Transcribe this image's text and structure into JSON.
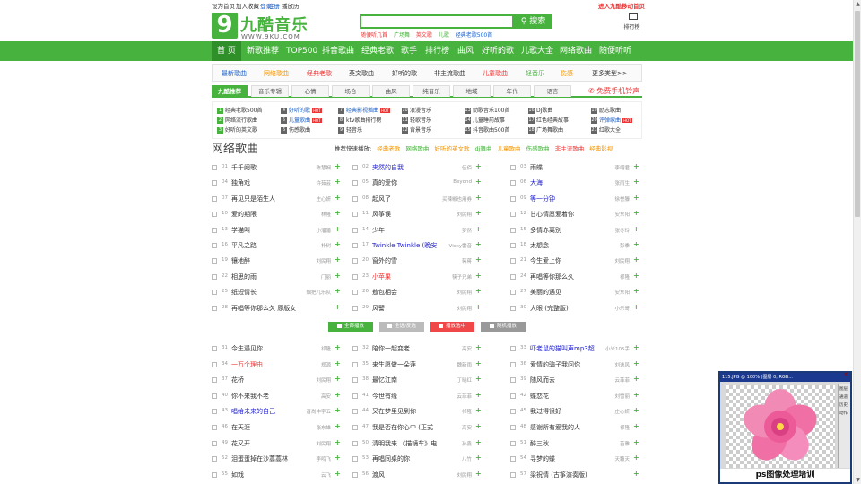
{
  "topbar": {
    "set_home": "设为首页",
    "favorite": "加入收藏",
    "login": "登录",
    "register": "注册",
    "history": "播放历",
    "link_to_mobile": "进入九酷移动首页"
  },
  "logo": {
    "mark": "9",
    "name": "九酷音乐",
    "url": "WWW.9KU.COM"
  },
  "search": {
    "placeholder": "",
    "button": "搜索"
  },
  "hotwords": [
    "随便听几首",
    "广场舞",
    "英文歌",
    "儿歌",
    "经典老歌500首"
  ],
  "rank_label": "排行榜",
  "nav": [
    "首 页",
    "新歌推荐",
    "TOP500",
    "抖音歌曲",
    "经典老歌",
    "歌手",
    "排行榜",
    "曲风",
    "好听的歌",
    "儿歌大全",
    "网络歌曲",
    "随便听听"
  ],
  "subnav": [
    "最新歌曲",
    "网络歌曲",
    "经典老歌",
    "英文歌曲",
    "好听的歌",
    "非主流歌曲",
    "儿童歌曲",
    "轻音乐",
    "伤感",
    "更多类型>>"
  ],
  "tabs": [
    "九酷推荐",
    "音乐专辑",
    "心情",
    "场合",
    "曲风",
    "纯音乐",
    "地域",
    "年代",
    "语言"
  ],
  "promo": "免费手机铃声",
  "categories": [
    {
      "n": "1",
      "label": "经典老歌500首",
      "hot": ""
    },
    {
      "n": "4",
      "label": "好听的歌",
      "hot": "HOT"
    },
    {
      "n": "7",
      "label": "经典影视插曲",
      "hot": "HOT"
    },
    {
      "n": "10",
      "label": "浪漫音乐",
      "hot": ""
    },
    {
      "n": "13",
      "label": "勁歌音乐100首",
      "hot": ""
    },
    {
      "n": "16",
      "label": "DJ歌曲",
      "hot": ""
    },
    {
      "n": "19",
      "label": "励志歌曲",
      "hot": ""
    },
    {
      "n": "2",
      "label": "网络流行歌曲",
      "hot": ""
    },
    {
      "n": "5",
      "label": "儿童歌曲",
      "hot": "HOT"
    },
    {
      "n": "8",
      "label": "ktv歌曲排行榜",
      "hot": ""
    },
    {
      "n": "11",
      "label": "轻歌音乐",
      "hot": ""
    },
    {
      "n": "14",
      "label": "儿童睡前故事",
      "hot": ""
    },
    {
      "n": "17",
      "label": "红色经典故事",
      "hot": ""
    },
    {
      "n": "20",
      "label": "评弹歌曲",
      "hot": "HOT"
    },
    {
      "n": "3",
      "label": "好听的英文歌",
      "hot": ""
    },
    {
      "n": "6",
      "label": "伤感歌曲",
      "hot": ""
    },
    {
      "n": "9",
      "label": "轻音乐",
      "hot": ""
    },
    {
      "n": "12",
      "label": "背景音乐",
      "hot": ""
    },
    {
      "n": "15",
      "label": "抖音歌曲500首",
      "hot": ""
    },
    {
      "n": "18",
      "label": "广场舞歌曲",
      "hot": ""
    },
    {
      "n": "21",
      "label": "红歌大全",
      "hot": ""
    }
  ],
  "section_title": "网络歌曲",
  "quick": {
    "label": "推荐快速播放:",
    "items": [
      {
        "text": "经典老歌",
        "color": "#f29400"
      },
      {
        "text": "网络歌曲",
        "color": "#47b33e"
      },
      {
        "text": "好听的英文歌",
        "color": "#f29400"
      },
      {
        "text": "dj舞曲",
        "color": "#47b33e"
      },
      {
        "text": "儿童歌曲",
        "color": "#f29400"
      },
      {
        "text": "伤感歌曲",
        "color": "#47b33e"
      },
      {
        "text": "非主流歌曲",
        "color": "#e33"
      },
      {
        "text": "经典影视",
        "color": "#f29400"
      }
    ]
  },
  "songs_top": [
    [
      {
        "no": "01",
        "title": "千千阙歌",
        "singer": "陈慧娴",
        "color": "#333"
      },
      {
        "no": "04",
        "title": "独角戏",
        "singer": "许茹芸",
        "color": "#333"
      },
      {
        "no": "07",
        "title": "再见只是陌生人",
        "singer": "庄心妍",
        "color": "#333"
      },
      {
        "no": "10",
        "title": "爱的期限",
        "singer": "林隆",
        "color": "#333"
      },
      {
        "no": "13",
        "title": "学猫叫",
        "singer": "小潘潘",
        "color": "#333"
      },
      {
        "no": "16",
        "title": "平凡之路",
        "singer": "朴树",
        "color": "#333"
      },
      {
        "no": "19",
        "title": "镶地醉",
        "singer": "刘民翔",
        "color": "#333"
      },
      {
        "no": "22",
        "title": "相思的雨",
        "singer": "门丽",
        "color": "#333"
      },
      {
        "no": "25",
        "title": "纸短情长",
        "singer": "烟把儿乐队",
        "color": "#333"
      },
      {
        "no": "28",
        "title": "再唱等你那么久 原版女",
        "singer": "",
        "color": "#333"
      }
    ],
    [
      {
        "no": "02",
        "title": "夹然的自我",
        "singer": "伍佰",
        "color": "#22c"
      },
      {
        "no": "05",
        "title": "真的爱你",
        "singer": "Beyond",
        "color": "#333"
      },
      {
        "no": "08",
        "title": "起风了",
        "singer": "买辣椒也用券",
        "color": "#333"
      },
      {
        "no": "11",
        "title": "风筝误",
        "singer": "刘民翔",
        "color": "#333"
      },
      {
        "no": "14",
        "title": "少年",
        "singer": "梦然",
        "color": "#333"
      },
      {
        "no": "17",
        "title": "Twinkle Twinkle (晚安",
        "singer": "Vicky雷音",
        "color": "#22c"
      },
      {
        "no": "20",
        "title": "窗外的雪",
        "singer": "蒋蒋",
        "color": "#333"
      },
      {
        "no": "23",
        "title": "小苹果",
        "singer": "筷子兄弟",
        "color": "#e33"
      },
      {
        "no": "26",
        "title": "敖包相会",
        "singer": "刘民翔",
        "color": "#333"
      },
      {
        "no": "29",
        "title": "风譬",
        "singer": "刘民翔",
        "color": "#333"
      }
    ],
    [
      {
        "no": "03",
        "title": "雨蝶",
        "singer": "李翊君",
        "color": "#333"
      },
      {
        "no": "06",
        "title": "大海",
        "singer": "张雨生",
        "color": "#22c"
      },
      {
        "no": "09",
        "title": "等一分钟",
        "singer": "徐誉滕",
        "color": "#22c"
      },
      {
        "no": "12",
        "title": "甘心情愿爱着你",
        "singer": "安东阳",
        "color": "#333"
      },
      {
        "no": "15",
        "title": "多情赤离别",
        "singer": "张冬玲",
        "color": "#333"
      },
      {
        "no": "18",
        "title": "太想念",
        "singer": "彭季",
        "color": "#333"
      },
      {
        "no": "21",
        "title": "今生爱上你",
        "singer": "刘民翔",
        "color": "#333"
      },
      {
        "no": "24",
        "title": "再唱等你那么久",
        "singer": "祁隆",
        "color": "#333"
      },
      {
        "no": "27",
        "title": "美丽的遇见",
        "singer": "安东阳",
        "color": "#333"
      },
      {
        "no": "30",
        "title": "大眼 (完整版)",
        "singer": "小乐哥",
        "color": "#333"
      }
    ]
  ],
  "actions": [
    {
      "label": "全部播放",
      "color": "#47b33e"
    },
    {
      "label": "全选/反选",
      "color": "#bbb"
    },
    {
      "label": "播放选中",
      "color": "#f04848"
    },
    {
      "label": "随机播放",
      "color": "#999"
    }
  ],
  "songs_bottom": [
    [
      {
        "no": "31",
        "title": "今生遇见你",
        "singer": "祁隆",
        "color": "#333"
      },
      {
        "no": "34",
        "title": "一万个理由",
        "singer": "郑源",
        "color": "#e33"
      },
      {
        "no": "37",
        "title": "花桥",
        "singer": "刘民翔",
        "color": "#333"
      },
      {
        "no": "40",
        "title": "你不来我不老",
        "singer": "高安",
        "color": "#333"
      },
      {
        "no": "43",
        "title": "唱给未来的自己",
        "singer": "音尚中字五",
        "color": "#22c"
      },
      {
        "no": "46",
        "title": "在天涯",
        "singer": "张东雄",
        "color": "#333"
      },
      {
        "no": "49",
        "title": "花又开",
        "singer": "刘民翔",
        "color": "#333"
      },
      {
        "no": "52",
        "title": "泪蛋蛋掉在沙蒿蒿林",
        "singer": "李鸣飞",
        "color": "#333"
      },
      {
        "no": "55",
        "title": "如戏",
        "singer": "云飞",
        "color": "#333"
      }
    ],
    [
      {
        "no": "32",
        "title": "陪你一起变老",
        "singer": "高安",
        "color": "#333"
      },
      {
        "no": "35",
        "title": "来生愿做一朵莲",
        "singer": "魏新雨",
        "color": "#333"
      },
      {
        "no": "38",
        "title": "最忆江南",
        "singer": "丁晓红",
        "color": "#333"
      },
      {
        "no": "41",
        "title": "今世有缘",
        "singer": "云菲菲",
        "color": "#333"
      },
      {
        "no": "44",
        "title": "又在梦里见到你",
        "singer": "祁隆",
        "color": "#333"
      },
      {
        "no": "47",
        "title": "我是否在你心中 (正式",
        "singer": "高安",
        "color": "#333"
      },
      {
        "no": "50",
        "title": "清明我来 《描镜车》电",
        "singer": "孙鑫",
        "color": "#333"
      },
      {
        "no": "53",
        "title": "再唱同桌的你",
        "singer": "八竹",
        "color": "#333"
      },
      {
        "no": "56",
        "title": "渡风",
        "singer": "刘民翔",
        "color": "#333"
      }
    ],
    [
      {
        "no": "33",
        "title": "吓老鼠的猫叫声mp3超",
        "singer": "小米105手",
        "color": "#22c"
      },
      {
        "no": "36",
        "title": "爱情的骗子我问你",
        "singer": "刘逸风",
        "color": "#333"
      },
      {
        "no": "39",
        "title": "随风而去",
        "singer": "云菲菲",
        "color": "#333"
      },
      {
        "no": "42",
        "title": "蝶恋花",
        "singer": "刘雪丽",
        "color": "#333"
      },
      {
        "no": "45",
        "title": "我过得很好",
        "singer": "庄心妍",
        "color": "#333"
      },
      {
        "no": "48",
        "title": "感谢所有爱我的人",
        "singer": "祁隆",
        "color": "#333"
      },
      {
        "no": "51",
        "title": "醉三秋",
        "singer": "苗雅",
        "color": "#333"
      },
      {
        "no": "54",
        "title": "寻梦的蝶",
        "singer": "天籁天",
        "color": "#333"
      },
      {
        "no": "57",
        "title": "梁祝情 (古筝演奏版)",
        "singer": "",
        "color": "#333"
      }
    ]
  ],
  "ad": {
    "window_title": "115.JPG @ 100% (图层 0, RGB...",
    "panel_labels": [
      "图层",
      "通道",
      "历史",
      "动作"
    ],
    "caption": "ps图像处理培训"
  }
}
